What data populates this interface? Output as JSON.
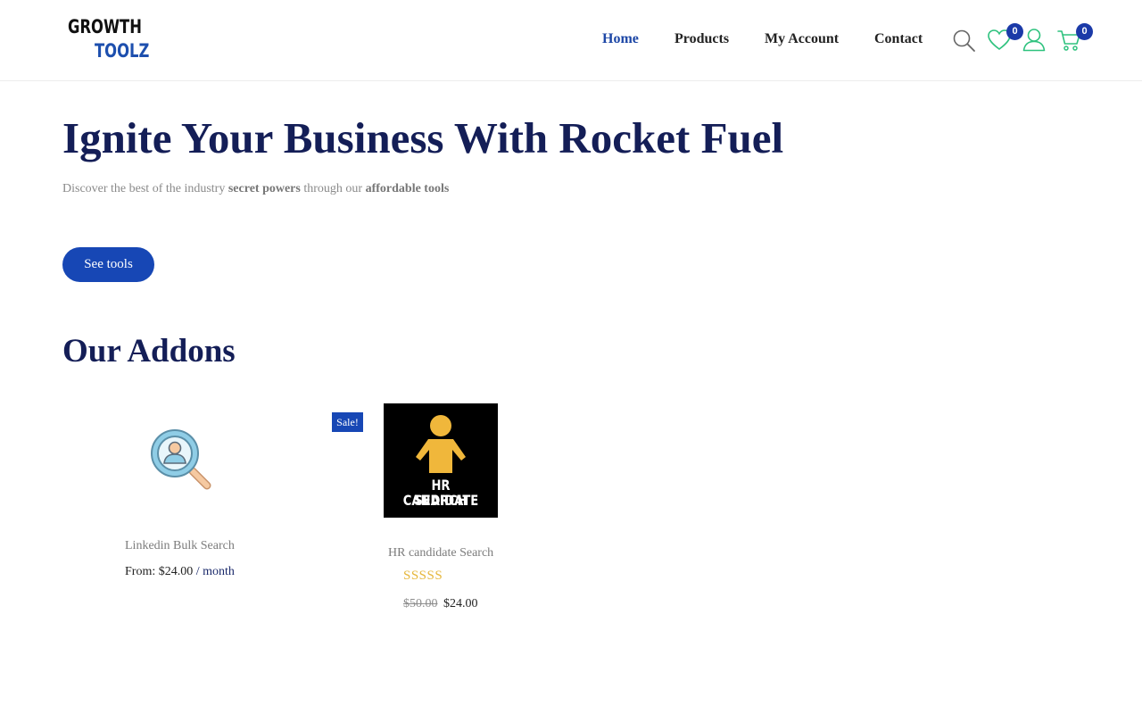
{
  "brand": {
    "logo_line1": "GROWTH",
    "logo_line2": "TOOLZ",
    "accent_color": "#1d4fae",
    "heading_color": "#141e57"
  },
  "nav": {
    "items": [
      {
        "label": "Home",
        "active": true
      },
      {
        "label": "Products",
        "active": false
      },
      {
        "label": "My Account",
        "active": false
      },
      {
        "label": "Contact",
        "active": false
      }
    ]
  },
  "header_icons": {
    "search": "search-icon",
    "wishlist": "heart-icon",
    "wishlist_count": "0",
    "account": "user-icon",
    "cart": "cart-icon",
    "cart_count": "0",
    "icon_color": "#2ec27e"
  },
  "hero": {
    "title": "Ignite Your Business With Rocket Fuel",
    "subtitle_part1": "Discover the best of the industry ",
    "subtitle_bold1": "secret powers",
    "subtitle_part2": " through our ",
    "subtitle_bold2": "affordable tools",
    "cta_label": "See tools"
  },
  "addons": {
    "section_title": "Our Addons",
    "products": [
      {
        "name": "Linkedin Bulk Search",
        "price_prefix": "From: ",
        "price": "$24.00",
        "price_suffix": " / month",
        "image_icon": "magnifier-person-icon"
      },
      {
        "name": "HR candidate Search",
        "sale_badge": "Sale!",
        "image_text_line1": "HR CANDIDATE",
        "image_text_line2": "SEARCH",
        "rating_text": "SSSSS",
        "old_price": "$50.00",
        "price": "$24.00"
      }
    ]
  }
}
